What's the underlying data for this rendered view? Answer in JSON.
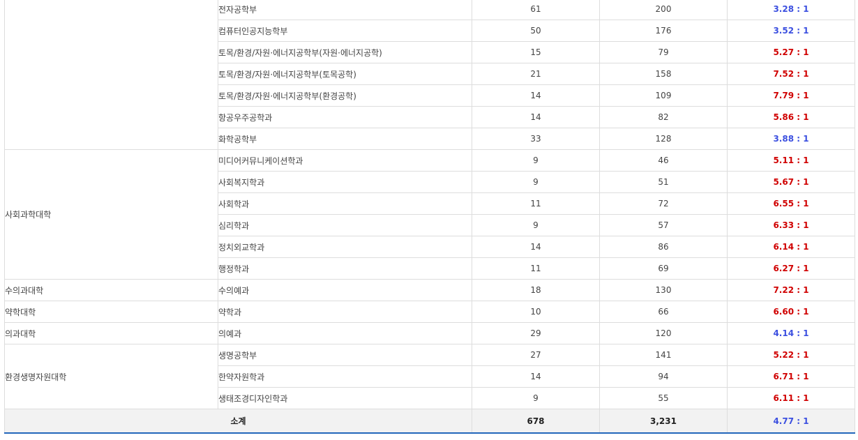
{
  "colors": {
    "rate_high": "#d00000",
    "rate_low": "#3c50e0",
    "border": "#dddddd",
    "total_bg": "#f2f2f2",
    "total_border": "#2266bb"
  },
  "groups": [
    {
      "college": "",
      "rows": [
        {
          "dept": "전자공학부",
          "quota": "61",
          "applicants": "200",
          "rate": "3.28 : 1",
          "level": "low"
        },
        {
          "dept": "컴퓨터인공지능학부",
          "quota": "50",
          "applicants": "176",
          "rate": "3.52 : 1",
          "level": "low"
        },
        {
          "dept": "토목/환경/자원·에너지공학부(자원·에너지공학)",
          "quota": "15",
          "applicants": "79",
          "rate": "5.27 : 1",
          "level": "high"
        },
        {
          "dept": "토목/환경/자원·에너지공학부(토목공학)",
          "quota": "21",
          "applicants": "158",
          "rate": "7.52 : 1",
          "level": "high"
        },
        {
          "dept": "토목/환경/자원·에너지공학부(환경공학)",
          "quota": "14",
          "applicants": "109",
          "rate": "7.79 : 1",
          "level": "high"
        },
        {
          "dept": "항공우주공학과",
          "quota": "14",
          "applicants": "82",
          "rate": "5.86 : 1",
          "level": "high"
        },
        {
          "dept": "화학공학부",
          "quota": "33",
          "applicants": "128",
          "rate": "3.88 : 1",
          "level": "low"
        }
      ]
    },
    {
      "college": "사회과학대학",
      "rows": [
        {
          "dept": "미디어커뮤니케이션학과",
          "quota": "9",
          "applicants": "46",
          "rate": "5.11 : 1",
          "level": "high"
        },
        {
          "dept": "사회복지학과",
          "quota": "9",
          "applicants": "51",
          "rate": "5.67 : 1",
          "level": "high"
        },
        {
          "dept": "사회학과",
          "quota": "11",
          "applicants": "72",
          "rate": "6.55 : 1",
          "level": "high"
        },
        {
          "dept": "심리학과",
          "quota": "9",
          "applicants": "57",
          "rate": "6.33 : 1",
          "level": "high"
        },
        {
          "dept": "정치외교학과",
          "quota": "14",
          "applicants": "86",
          "rate": "6.14 : 1",
          "level": "high"
        },
        {
          "dept": "행정학과",
          "quota": "11",
          "applicants": "69",
          "rate": "6.27 : 1",
          "level": "high"
        }
      ]
    },
    {
      "college": "수의과대학",
      "rows": [
        {
          "dept": "수의예과",
          "quota": "18",
          "applicants": "130",
          "rate": "7.22 : 1",
          "level": "high"
        }
      ]
    },
    {
      "college": "약학대학",
      "rows": [
        {
          "dept": "약학과",
          "quota": "10",
          "applicants": "66",
          "rate": "6.60 : 1",
          "level": "high"
        }
      ]
    },
    {
      "college": "의과대학",
      "rows": [
        {
          "dept": "의예과",
          "quota": "29",
          "applicants": "120",
          "rate": "4.14 : 1",
          "level": "low"
        }
      ]
    },
    {
      "college": "환경생명자원대학",
      "rows": [
        {
          "dept": "생명공학부",
          "quota": "27",
          "applicants": "141",
          "rate": "5.22 : 1",
          "level": "high"
        },
        {
          "dept": "한약자원학과",
          "quota": "14",
          "applicants": "94",
          "rate": "6.71 : 1",
          "level": "high"
        },
        {
          "dept": "생태조경디자인학과",
          "quota": "9",
          "applicants": "55",
          "rate": "6.11 : 1",
          "level": "high"
        }
      ]
    }
  ],
  "total": {
    "label": "소계",
    "quota": "678",
    "applicants": "3,231",
    "rate": "4.77 : 1"
  }
}
